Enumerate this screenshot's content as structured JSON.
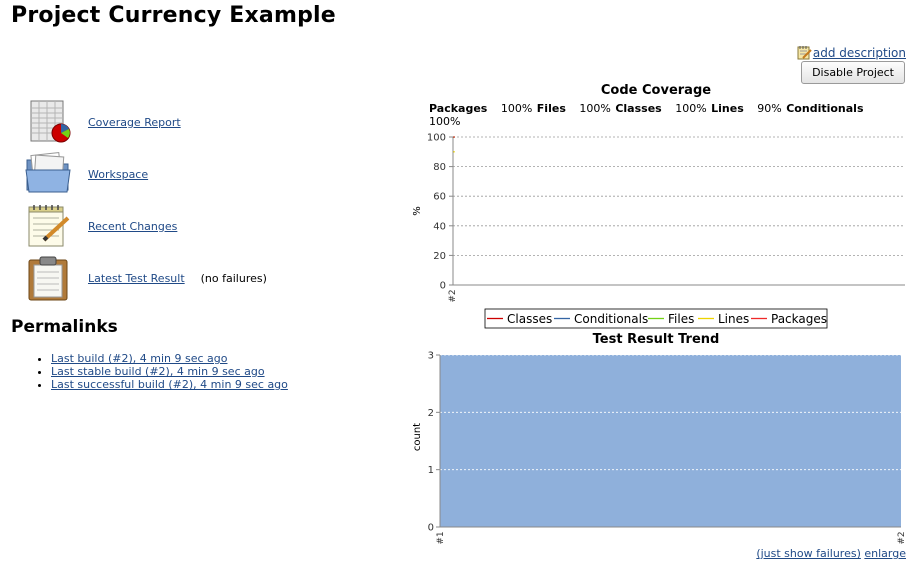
{
  "page": {
    "title": "Project Currency Example",
    "add_description": "add description",
    "disable_button": "Disable Project"
  },
  "tasks": [
    {
      "label": "Coverage Report",
      "icon": "coverage-report-icon",
      "note": ""
    },
    {
      "label": "Workspace",
      "icon": "folder-icon",
      "note": ""
    },
    {
      "label": "Recent Changes",
      "icon": "notepad-icon",
      "note": ""
    },
    {
      "label": "Latest Test Result",
      "icon": "clipboard-icon",
      "note": "(no failures)"
    }
  ],
  "permalinks": {
    "heading": "Permalinks",
    "items": [
      "Last build (#2), 4 min 9 sec ago",
      "Last stable build (#2), 4 min 9 sec ago",
      "Last successful build (#2), 4 min 9 sec ago"
    ]
  },
  "coverage_summary": [
    {
      "name": "Packages",
      "value": "100%"
    },
    {
      "name": "Files",
      "value": "100%"
    },
    {
      "name": "Classes",
      "value": "100%"
    },
    {
      "name": "Lines",
      "value": "90%"
    },
    {
      "name": "Conditionals",
      "value": "100%"
    }
  ],
  "footer": {
    "just_show_failures": "(just show failures)",
    "enlarge": "enlarge"
  },
  "colors": {
    "link": "#204a87",
    "test_area": "#8fb0db",
    "classes": "#cc0000",
    "conditionals": "#3465a4",
    "files": "#73d216",
    "lines": "#edd400",
    "packages": "#ef2929"
  },
  "chart_data": [
    {
      "type": "line",
      "title": "Code Coverage",
      "xlabel": "",
      "ylabel": "%",
      "categories": [
        "#2"
      ],
      "ylim": [
        0,
        100
      ],
      "yticks": [
        0,
        20,
        40,
        60,
        80,
        100
      ],
      "grid": true,
      "legend": "bottom",
      "series": [
        {
          "name": "Classes",
          "values": [
            100
          ]
        },
        {
          "name": "Conditionals",
          "values": [
            100
          ]
        },
        {
          "name": "Files",
          "values": [
            100
          ]
        },
        {
          "name": "Lines",
          "values": [
            90
          ]
        },
        {
          "name": "Packages",
          "values": [
            100
          ]
        }
      ]
    },
    {
      "type": "area",
      "title": "Test Result Trend",
      "xlabel": "",
      "ylabel": "count",
      "categories": [
        "#1",
        "#2"
      ],
      "ylim": [
        0,
        3
      ],
      "yticks": [
        0,
        1,
        2,
        3
      ],
      "grid": true,
      "series": [
        {
          "name": "",
          "values": [
            3,
            3
          ]
        }
      ]
    }
  ]
}
